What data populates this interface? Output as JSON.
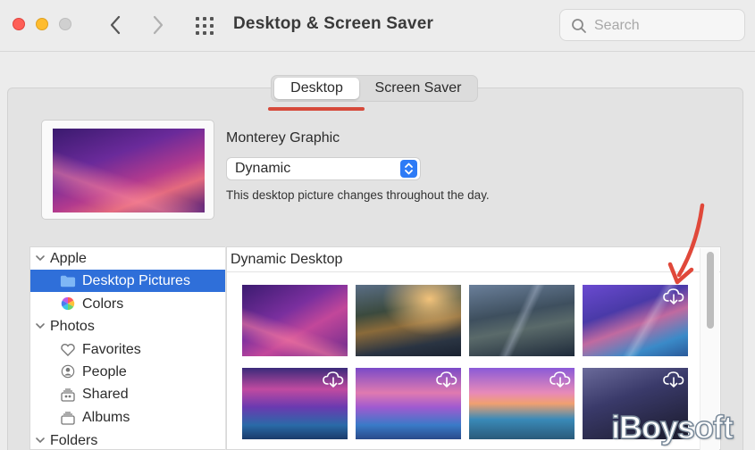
{
  "window": {
    "title": "Desktop & Screen Saver",
    "search_placeholder": "Search"
  },
  "tabs": [
    {
      "label": "Desktop",
      "selected": true
    },
    {
      "label": "Screen Saver",
      "selected": false
    }
  ],
  "current": {
    "name": "Monterey Graphic",
    "mode": "Dynamic",
    "description": "This desktop picture changes throughout the day."
  },
  "sidebar": {
    "groups": [
      {
        "label": "Apple",
        "items": [
          {
            "label": "Desktop Pictures",
            "icon": "folder-icon",
            "selected": true
          },
          {
            "label": "Colors",
            "icon": "color-wheel-icon",
            "selected": false
          }
        ]
      },
      {
        "label": "Photos",
        "items": [
          {
            "label": "Favorites",
            "icon": "heart-icon",
            "selected": false
          },
          {
            "label": "People",
            "icon": "person-icon",
            "selected": false
          },
          {
            "label": "Shared",
            "icon": "shared-album-icon",
            "selected": false
          },
          {
            "label": "Albums",
            "icon": "album-icon",
            "selected": false
          }
        ]
      },
      {
        "label": "Folders",
        "items": []
      }
    ]
  },
  "grid": {
    "section_label": "Dynamic Desktop",
    "thumbnails": [
      {
        "name": "monterey-graphic",
        "download": false
      },
      {
        "name": "catalina-day",
        "download": false
      },
      {
        "name": "catalina-split",
        "download": false
      },
      {
        "name": "coast-purple",
        "download": true
      },
      {
        "name": "lake-dusk",
        "download": true
      },
      {
        "name": "lake-sunset",
        "download": true
      },
      {
        "name": "coast-sunset",
        "download": true
      },
      {
        "name": "abstract-dark",
        "download": true
      }
    ]
  },
  "colors": {
    "accent": "#2f6fd9",
    "annotation": "#d64a3b"
  },
  "watermark": "iBoysoft"
}
